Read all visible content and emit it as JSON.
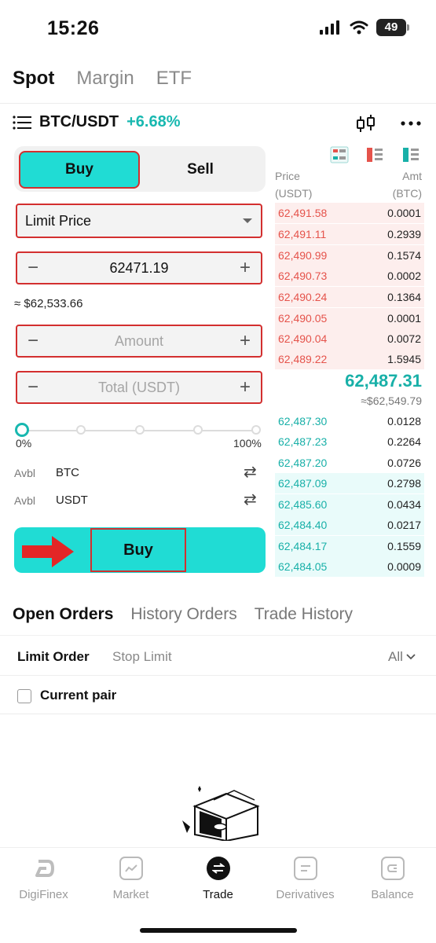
{
  "status_bar": {
    "time": "15:26",
    "battery": "49"
  },
  "top_tabs": [
    {
      "label": "Spot",
      "active": true
    },
    {
      "label": "Margin",
      "active": false
    },
    {
      "label": "ETF",
      "active": false
    }
  ],
  "pair": {
    "name": "BTC/USDT",
    "change": "+6.68%"
  },
  "trade_panel": {
    "buy_label": "Buy",
    "sell_label": "Sell",
    "order_type": "Limit Price",
    "price_value": "62471.19",
    "approx_value": "≈ $62,533.66",
    "amount_placeholder": "Amount",
    "total_placeholder": "Total (USDT)",
    "slider_min": "0%",
    "slider_max": "100%",
    "avbl": [
      {
        "label": "Avbl",
        "currency": "BTC"
      },
      {
        "label": "Avbl",
        "currency": "USDT"
      }
    ],
    "submit_label": "Buy"
  },
  "order_book": {
    "price_header": "Price",
    "price_unit": "(USDT)",
    "amount_header": "Amt",
    "amount_unit": "(BTC)",
    "asks": [
      {
        "price": "62,491.58",
        "amount": "0.0001"
      },
      {
        "price": "62,491.11",
        "amount": "0.2939"
      },
      {
        "price": "62,490.99",
        "amount": "0.1574"
      },
      {
        "price": "62,490.73",
        "amount": "0.0002"
      },
      {
        "price": "62,490.24",
        "amount": "0.1364"
      },
      {
        "price": "62,490.05",
        "amount": "0.0001"
      },
      {
        "price": "62,490.04",
        "amount": "0.0072"
      },
      {
        "price": "62,489.22",
        "amount": "1.5945"
      }
    ],
    "last_price": "62,487.31",
    "last_price_usd": "≈$62,549.79",
    "bids": [
      {
        "price": "62,487.30",
        "amount": "0.0128"
      },
      {
        "price": "62,487.23",
        "amount": "0.2264"
      },
      {
        "price": "62,487.20",
        "amount": "0.0726"
      },
      {
        "price": "62,487.09",
        "amount": "0.2798"
      },
      {
        "price": "62,485.60",
        "amount": "0.0434"
      },
      {
        "price": "62,484.40",
        "amount": "0.0217"
      },
      {
        "price": "62,484.17",
        "amount": "0.1559"
      },
      {
        "price": "62,484.05",
        "amount": "0.0009"
      }
    ]
  },
  "orders_section": {
    "tabs": [
      {
        "label": "Open Orders",
        "active": true
      },
      {
        "label": "History Orders",
        "active": false
      },
      {
        "label": "Trade History",
        "active": false
      }
    ],
    "sub_tabs": [
      {
        "label": "Limit Order",
        "active": true
      },
      {
        "label": "Stop Limit",
        "active": false
      }
    ],
    "filter": "All",
    "current_pair_label": "Current pair"
  },
  "bottom_nav": [
    {
      "label": "DigiFinex",
      "icon": "digifinex-logo-icon",
      "active": false
    },
    {
      "label": "Market",
      "icon": "market-chart-icon",
      "active": false
    },
    {
      "label": "Trade",
      "icon": "trade-swap-icon",
      "active": true
    },
    {
      "label": "Derivatives",
      "icon": "derivatives-icon",
      "active": false
    },
    {
      "label": "Balance",
      "icon": "balance-wallet-icon",
      "active": false
    }
  ],
  "colors": {
    "accent": "#20dcd4",
    "bid": "#18b0a8",
    "ask": "#e5534b",
    "highlight_box": "#d32f2f"
  }
}
